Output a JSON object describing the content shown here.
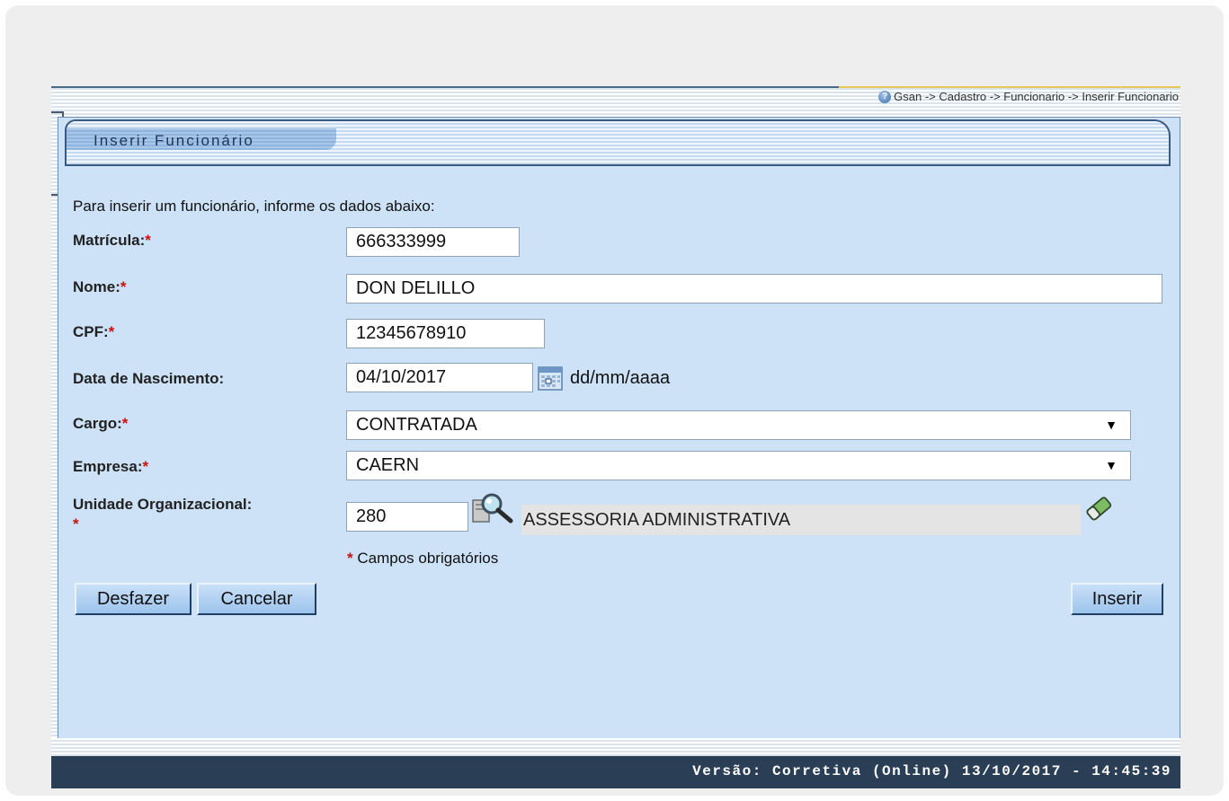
{
  "breadcrumb": "Gsan -> Cadastro -> Funcionario -> Inserir Funcionario",
  "panel": {
    "title": "Inserir Funcionário",
    "intro": "Para inserir um funcionário, informe os dados abaixo:"
  },
  "form": {
    "matricula": {
      "label": "Matrícula:",
      "required_mark": "*",
      "value": "666333999"
    },
    "nome": {
      "label": "Nome:",
      "required_mark": "*",
      "value": "DON DELILLO"
    },
    "cpf": {
      "label": "CPF:",
      "required_mark": "*",
      "value": "12345678910"
    },
    "nascimento": {
      "label": "Data de Nascimento:",
      "value": "04/10/2017",
      "format_hint": "dd/mm/aaaa"
    },
    "cargo": {
      "label": "Cargo:",
      "required_mark": "*",
      "selected": "CONTRATADA"
    },
    "empresa": {
      "label": "Empresa:",
      "required_mark": "*",
      "selected": "CAERN"
    },
    "unidade": {
      "label": "Unidade Organizacional:",
      "required_mark": "*",
      "code": "280",
      "name": "ASSESSORIA ADMINISTRATIVA"
    },
    "required_note": "Campos obrigatórios"
  },
  "buttons": {
    "desfazer": "Desfazer",
    "cancelar": "Cancelar",
    "inserir": "Inserir"
  },
  "footer": {
    "version": "Versão: Corretiva (Online) 13/10/2017 - 14:45:39"
  },
  "icons": {
    "help": "help-icon",
    "calendar": "calendar-icon",
    "search": "magnifier-icon",
    "clear": "eraser-icon"
  }
}
